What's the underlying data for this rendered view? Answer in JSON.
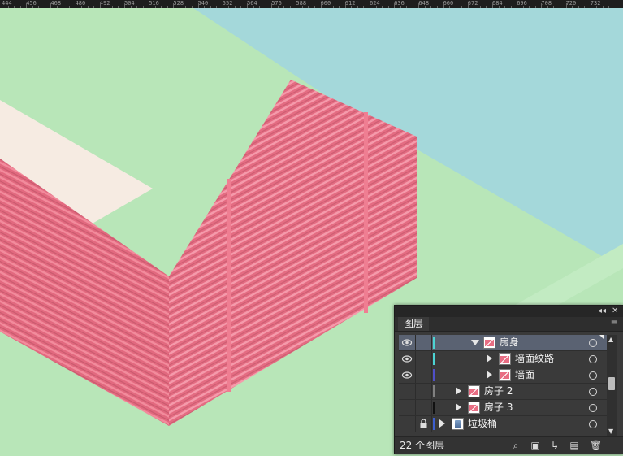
{
  "ruler": {
    "ticks": [
      "444",
      "456",
      "468",
      "480",
      "492",
      "504",
      "516",
      "528",
      "540",
      "552",
      "564",
      "576",
      "588",
      "600",
      "612",
      "624",
      "636",
      "648",
      "660",
      "672",
      "684",
      "696",
      "708",
      "720",
      "732"
    ]
  },
  "canvas": {
    "colors": {
      "ground_green": "#b8e6b8",
      "water_blue": "#a4d8da",
      "wall_pink": "#e86e84",
      "roof_cream": "#f6ebe2"
    }
  },
  "layers_panel": {
    "collapse_glyph": "◂◂",
    "close_glyph": "✕",
    "tab_label": "图层",
    "menu_glyph": "≡",
    "layers": [
      {
        "name": "房身",
        "visible": true,
        "locked": false,
        "expanded": true,
        "selected": true,
        "color": "#4cd3d3",
        "thumb": "red-house-thumbnail"
      },
      {
        "name": "墙面纹路",
        "visible": true,
        "locked": false,
        "expanded": false,
        "selected": false,
        "color": "#4cd3d3",
        "thumb": "red-house-thumbnail"
      },
      {
        "name": "墙面",
        "visible": true,
        "locked": false,
        "expanded": false,
        "selected": false,
        "color": "#4f4fc8",
        "thumb": "red-house-thumbnail"
      },
      {
        "name": "房子 2",
        "visible": false,
        "locked": false,
        "expanded": false,
        "selected": false,
        "color": "#808080",
        "thumb": "red-house-thumbnail"
      },
      {
        "name": "房子 3",
        "visible": false,
        "locked": false,
        "expanded": false,
        "selected": false,
        "color": "#111111",
        "thumb": "red-house-thumbnail"
      },
      {
        "name": "垃圾桶",
        "visible": false,
        "locked": true,
        "expanded": false,
        "selected": false,
        "color": "#3d5fd0",
        "thumb": "trash-bin-thumbnail"
      }
    ],
    "layer_count": "22 个图层",
    "footer_icons": [
      "search-icon",
      "make-clipping-mask-icon",
      "new-sublayer-icon",
      "new-layer-icon",
      "delete-icon"
    ]
  }
}
